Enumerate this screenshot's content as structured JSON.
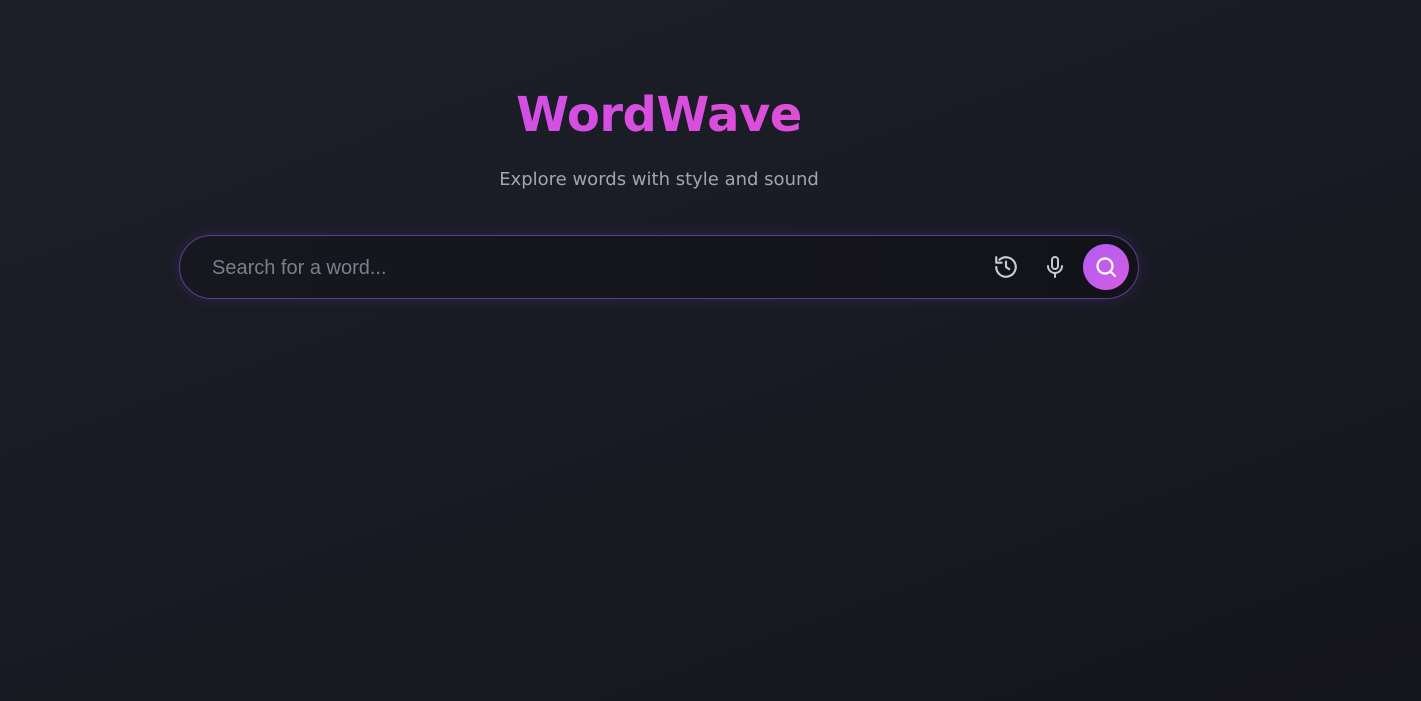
{
  "app": {
    "title": "WordWave",
    "subtitle": "Explore words with style and sound"
  },
  "search": {
    "placeholder": "Search for a word...",
    "value": ""
  },
  "icons": {
    "history": "history-icon",
    "microphone": "microphone-icon",
    "search": "search-icon"
  },
  "colors": {
    "background": "#1b1d26",
    "title_gradient_start": "#c252f2",
    "title_gradient_end": "#ec5bb5",
    "search_button": "#c05ceb",
    "border_accent": "#5a3f8c"
  }
}
